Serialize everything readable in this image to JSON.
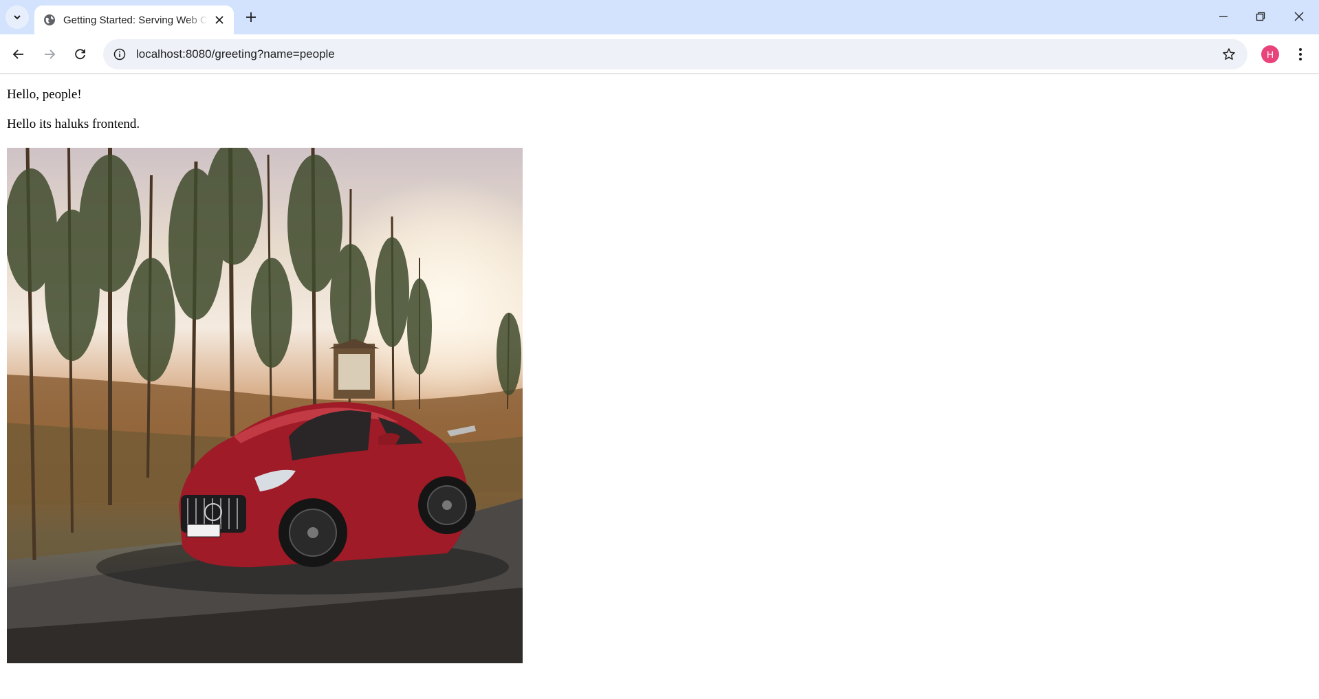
{
  "browser": {
    "tab": {
      "title": "Getting Started: Serving Web Content",
      "favicon": "globe-icon"
    },
    "address_bar": {
      "url": "localhost:8080/greeting?name=people"
    },
    "profile": {
      "initial": "H",
      "color": "#e8437a"
    }
  },
  "page": {
    "greeting": "Hello, people!",
    "message": "Hello its haluks frontend."
  },
  "colors": {
    "tabstrip": "#d3e3fd",
    "omnibox": "#eef1f8"
  }
}
